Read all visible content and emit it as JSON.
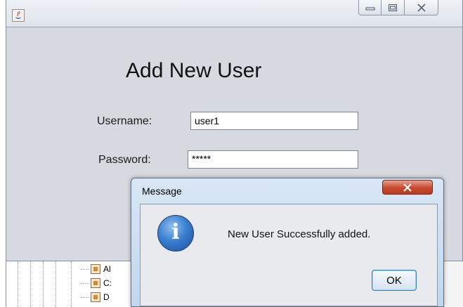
{
  "main_window": {
    "title_icon": "java-cup-icon",
    "controls": {
      "minimize_icon": "minimize-icon",
      "maximize_icon": "maximize-icon",
      "close_icon": "close-icon"
    },
    "form": {
      "title": "Add New User",
      "username_label": "Username:",
      "username_value": "user1",
      "password_label": "Password:",
      "password_value": "*****"
    }
  },
  "background_tree": {
    "items": [
      {
        "label": "Al",
        "icon": "package-icon"
      },
      {
        "label": "C:",
        "icon": "package-icon"
      },
      {
        "label": "D",
        "icon": "package-icon"
      }
    ]
  },
  "dialog": {
    "title": "Message",
    "close_icon": "close-icon",
    "icon": "info-icon",
    "icon_glyph": "i",
    "message": "New User Successfully added.",
    "ok_label": "OK",
    "colors": {
      "close_button": "#c8492e",
      "info_icon": "#3a7fd0",
      "ok_border": "#3c7fb1"
    }
  }
}
